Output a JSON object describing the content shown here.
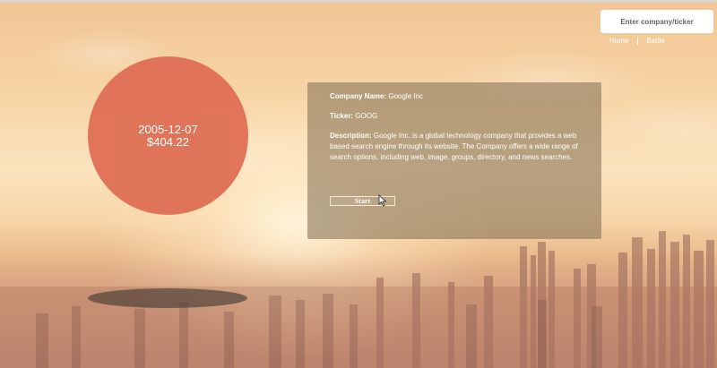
{
  "header": {
    "search": {
      "placeholder": "Enter company/ticker"
    },
    "nav": [
      {
        "label": "Home"
      },
      {
        "label": "Battle"
      }
    ]
  },
  "bubble": {
    "date": "2005-12-07",
    "price": "$404.22"
  },
  "company": {
    "name_label": "Company Name:",
    "name": "Google Inc",
    "ticker_label": "Ticker:",
    "ticker": "GOOG",
    "description_label": "Description:",
    "description": "Google Inc. is a global technology company that provides a web based search engine through its website. The Company offers a wide range of search options, including web, image, groups, directory, and news searches.",
    "start_label": "Start"
  },
  "colors": {
    "bubble": "#e07156",
    "panel": "#806c50",
    "background": "#f7d6a8"
  },
  "icons": {
    "cursor": "mouse-pointer-icon"
  }
}
